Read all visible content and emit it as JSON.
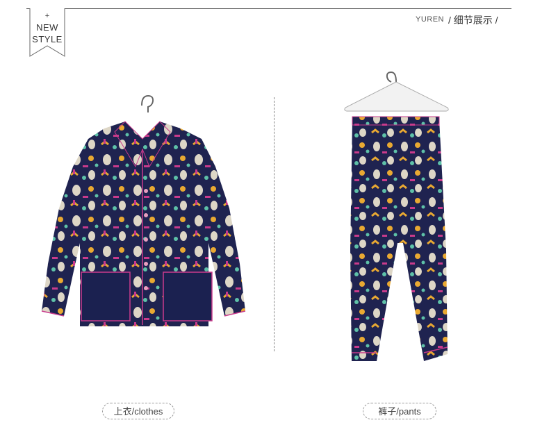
{
  "badge": {
    "plus": "+",
    "line1": "NEW",
    "line2": "STYLE"
  },
  "header": {
    "brand": "YUREN",
    "section": "/ 细节展示 /"
  },
  "products": [
    {
      "caption": "上衣/clothes",
      "color": "#1f2350"
    },
    {
      "caption": "裤子/pants",
      "color": "#1f2350"
    }
  ],
  "colors": {
    "navy": "#1f2350",
    "yellow": "#e9a932",
    "pink": "#c93b8c",
    "teal": "#5ec1a8",
    "cream": "#ddd6c6"
  }
}
